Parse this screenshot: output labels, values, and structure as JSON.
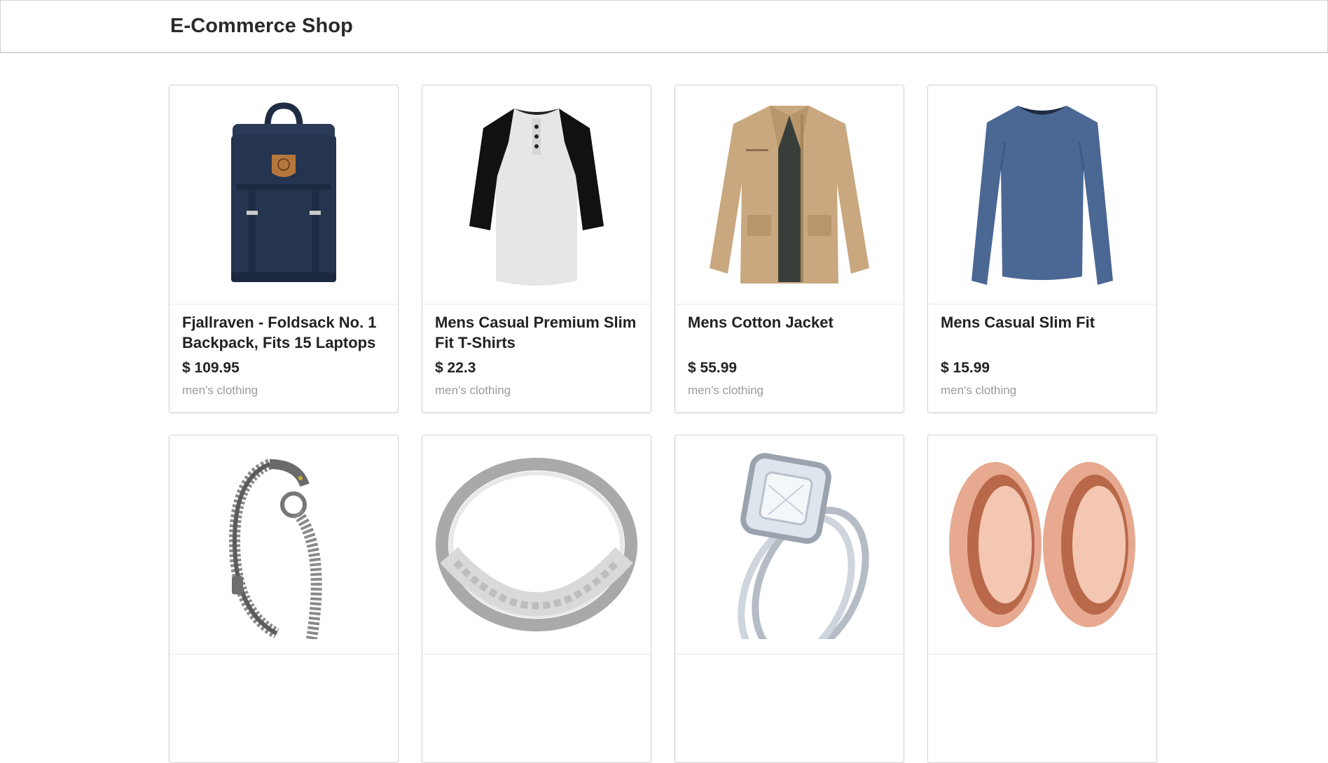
{
  "header": {
    "title": "E-Commerce Shop"
  },
  "products": [
    {
      "title": "Fjallraven - Foldsack No. 1 Backpack, Fits 15 Laptops",
      "price": "$ 109.95",
      "category": "men's clothing",
      "image": "backpack"
    },
    {
      "title": "Mens Casual Premium Slim Fit T-Shirts",
      "price": "$ 22.3",
      "category": "men's clothing",
      "image": "raglan-shirt"
    },
    {
      "title": "Mens Cotton Jacket",
      "price": "$ 55.99",
      "category": "men's clothing",
      "image": "jacket"
    },
    {
      "title": "Mens Casual Slim Fit",
      "price": "$ 15.99",
      "category": "men's clothing",
      "image": "long-sleeve-shirt"
    },
    {
      "title": "",
      "price": "",
      "category": "",
      "image": "chain-bracelet"
    },
    {
      "title": "",
      "price": "",
      "category": "",
      "image": "silver-ring"
    },
    {
      "title": "",
      "price": "",
      "category": "",
      "image": "diamond-ring-set"
    },
    {
      "title": "",
      "price": "",
      "category": "",
      "image": "rose-gold-tunnels"
    }
  ],
  "colors": {
    "border": "#d4d4d5",
    "text": "#222222",
    "muted": "#9a9a9a",
    "backpack": "#25344f",
    "jacket": "#c9a87f",
    "shirt": "#4b6894",
    "rose_gold": "#d98c6e"
  }
}
